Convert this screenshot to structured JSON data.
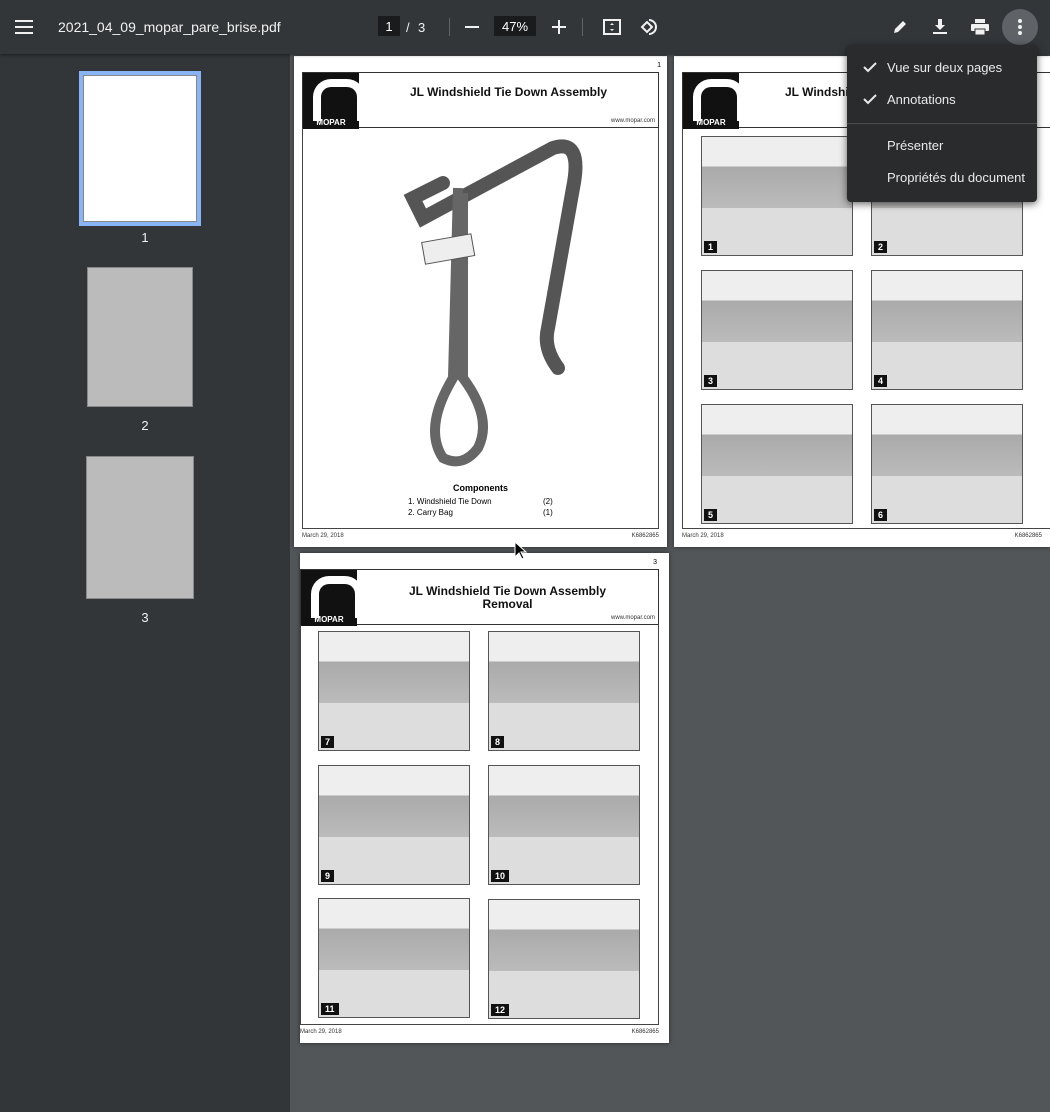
{
  "toolbar": {
    "title": "2021_04_09_mopar_pare_brise.pdf",
    "current_page": "1",
    "page_sep": "/",
    "total_pages": "3",
    "zoom": "47%"
  },
  "menu": {
    "items": [
      {
        "label": "Vue sur deux pages",
        "checked": true
      },
      {
        "label": "Annotations",
        "checked": true
      },
      {
        "label": "Présenter",
        "checked": false
      },
      {
        "label": "Propriétés du document",
        "checked": false
      }
    ]
  },
  "thumbnails": [
    {
      "label": "1",
      "selected": true
    },
    {
      "label": "2"
    },
    {
      "label": "3"
    }
  ],
  "pages": {
    "p1": {
      "num": "1",
      "title": "JL Windshield Tie Down Assembly",
      "url": "www.mopar.com",
      "logo": "MOPAR",
      "components_title": "Components",
      "components": [
        {
          "name": "1. Windshield Tie Down",
          "qty": "(2)"
        },
        {
          "name": "2. Carry Bag",
          "qty": "(1)"
        }
      ],
      "date": "March 29, 2018",
      "code": "K6862865"
    },
    "p2": {
      "title": "JL Windshi",
      "logo": "MOPAR",
      "steps": [
        "1",
        "2",
        "3",
        "4",
        "5",
        "6"
      ],
      "date": "March 29, 2018",
      "code": "K6862865"
    },
    "p3": {
      "num": "3",
      "title": "JL Windshield Tie Down Assembly",
      "title2": "Removal",
      "url": "www.mopar.com",
      "logo": "MOPAR",
      "steps": [
        "7",
        "8",
        "9",
        "10",
        "11",
        "12"
      ],
      "date": "March 29, 2018",
      "code": "K6862865"
    }
  }
}
